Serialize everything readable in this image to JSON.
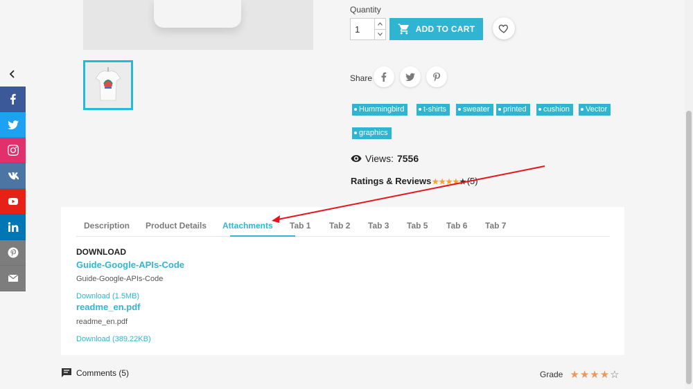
{
  "colors": {
    "accent": "#2fb5d2",
    "facebook": "#3b5998",
    "twitter": "#1da1f2",
    "instagram": "#e1306c",
    "vk": "#4c75a3",
    "youtube": "#e62117",
    "linkedin": "#0077b5",
    "pinterest": "#7d7d7d",
    "email": "#7d7d7d",
    "star": "#f5a623",
    "annotation": "#e8141a"
  },
  "side_share": {
    "collapse_icon": "chevron-left-icon",
    "items": [
      {
        "name": "facebook",
        "icon": "facebook-icon"
      },
      {
        "name": "twitter",
        "icon": "twitter-icon"
      },
      {
        "name": "instagram",
        "icon": "instagram-icon"
      },
      {
        "name": "vk",
        "icon": "vk-icon"
      },
      {
        "name": "youtube",
        "icon": "youtube-icon"
      },
      {
        "name": "linkedin",
        "icon": "linkedin-icon"
      },
      {
        "name": "pinterest",
        "icon": "pinterest-icon"
      },
      {
        "name": "email",
        "icon": "email-icon"
      }
    ]
  },
  "product": {
    "quantity_label": "Quantity",
    "quantity_value": "1",
    "add_to_cart_label": "ADD TO CART",
    "share_label": "Share",
    "tags": [
      "Hummingbird",
      "t-shirts",
      "sweater",
      "printed",
      "cushion",
      "Vector",
      "graphics"
    ],
    "views_label": "Views:",
    "views_value": "7556",
    "ratings_label": "Ratings & Reviews",
    "ratings_stars": 4,
    "ratings_count": "(5)"
  },
  "tabs": {
    "items": [
      "Description",
      "Product Details",
      "Attachments",
      "Tab 1",
      "Tab 2",
      "Tab 3",
      "Tab 5",
      "Tab 6",
      "Tab 7"
    ],
    "active": "Attachments"
  },
  "attachments": {
    "heading": "DOWNLOAD",
    "files": [
      {
        "title": "Guide-Google-APIs-Code",
        "description": "Guide-Google-APIs-Code",
        "link": "Download (1.5MB)"
      },
      {
        "title": "readme_en.pdf",
        "description": "readme_en.pdf",
        "link": "Download (389.22KB)"
      }
    ]
  },
  "footer": {
    "comments_label": "Comments (5)",
    "grade_label": "Grade",
    "grade_stars": 4
  }
}
